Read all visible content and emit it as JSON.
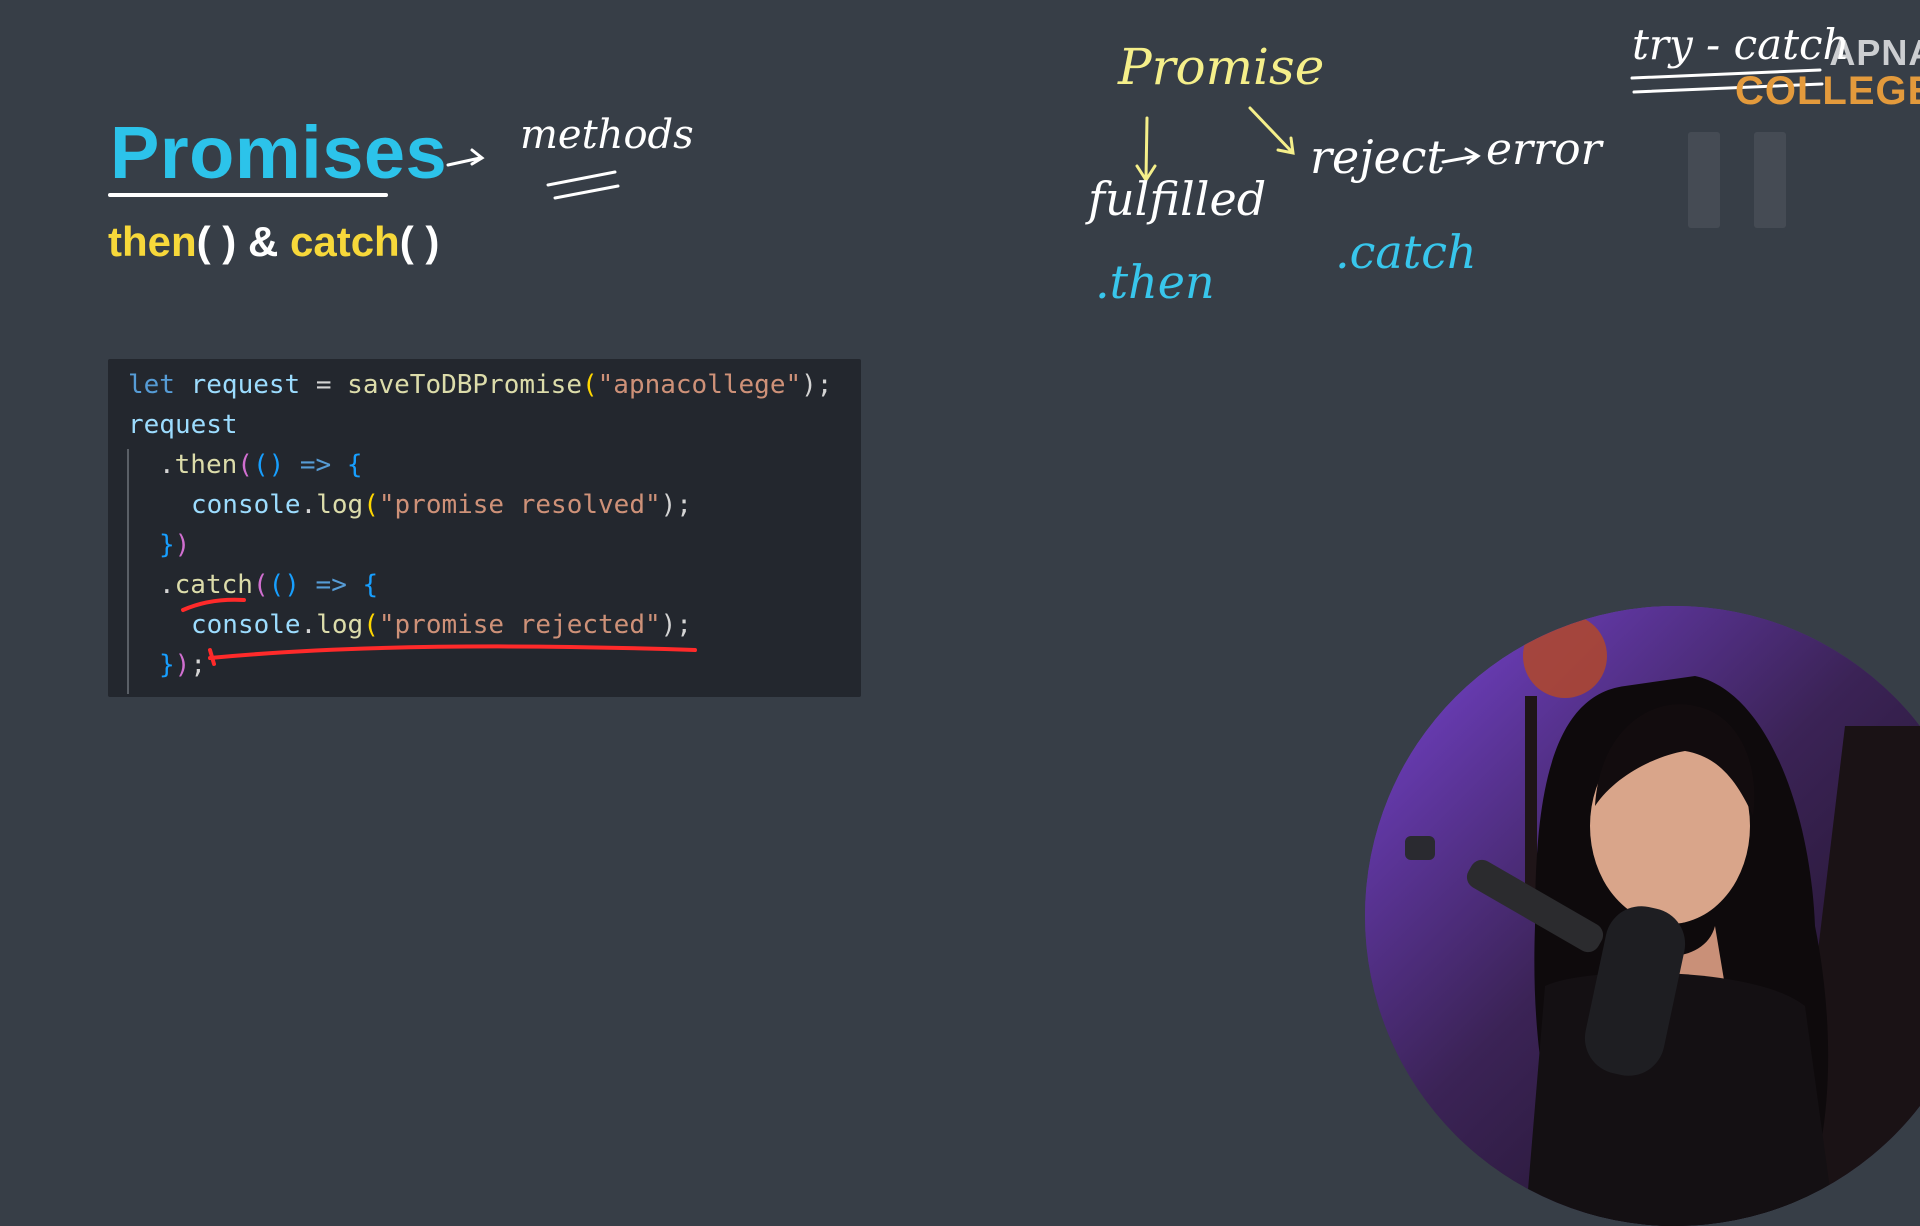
{
  "slide": {
    "title": "Promises",
    "subtitle_parts": {
      "then": "then",
      "then_parens": "( )",
      "amp": " & ",
      "catch": "catch",
      "catch_parens": "( )"
    }
  },
  "code": {
    "line1": {
      "kw": "let",
      "var": "request",
      "op": " = ",
      "fn": "saveToDBPromise",
      "open": "(",
      "str": "\"apnacollege\"",
      "close": ");"
    },
    "line2": {
      "var": "request"
    },
    "line3": {
      "dot": ".",
      "fn": "then",
      "paren_open": "(",
      "args": "()",
      "arrow": " => ",
      "brace": "{"
    },
    "line4": {
      "var": "console",
      "dot": ".",
      "fn": "log",
      "open": "(",
      "str": "\"promise resolved\"",
      "close": ");"
    },
    "line5": {
      "brace": "}",
      "paren": ")"
    },
    "line6": {
      "dot": ".",
      "fn": "catch",
      "paren_open": "(",
      "args": "()",
      "arrow": " => ",
      "brace": "{"
    },
    "line7": {
      "var": "console",
      "dot": ".",
      "fn": "log",
      "open": "(",
      "str": "\"promise rejected\"",
      "close": ");"
    },
    "line8": {
      "brace": "}",
      "paren": ")",
      "semi": ";"
    }
  },
  "annotations": {
    "methods": "methods",
    "promise": "Promise",
    "fulfilled": "fulfilled",
    "reject": "reject",
    "error": "error",
    "then": ".then",
    "catch": ".catch",
    "try_catch": "try - catch"
  },
  "logo": {
    "line1": "APNA",
    "line2": "COLLEGE"
  },
  "colors": {
    "background": "#373e47",
    "title": "#2cc3ea",
    "subtitle_keyword": "#f7d83a",
    "ink_white": "#ffffff",
    "ink_yellow": "#f5ef8a",
    "ink_cyan": "#38c6ec",
    "ink_red": "#ff2a2a"
  },
  "icons": {
    "pause": "pause-icon",
    "webcam": "presenter-webcam"
  }
}
